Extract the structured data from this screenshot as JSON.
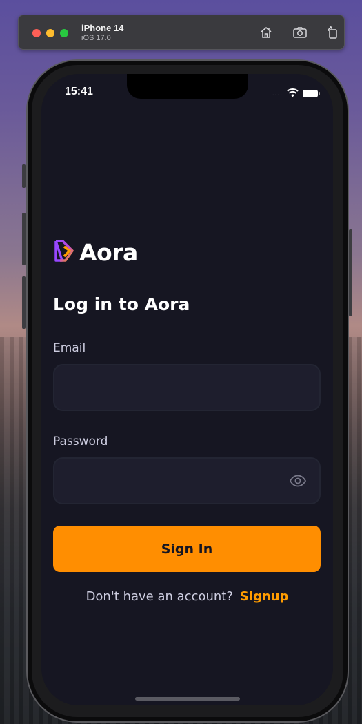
{
  "simulator": {
    "device_name": "iPhone 14",
    "os_version": "iOS 17.0",
    "icons": [
      "home-icon",
      "screenshot-icon",
      "rotate-icon"
    ]
  },
  "status_bar": {
    "time": "15:41",
    "signal": "....",
    "icons": [
      "wifi-icon",
      "battery-icon"
    ]
  },
  "app": {
    "logo_text": "Aora",
    "heading": "Log in to Aora",
    "email": {
      "label": "Email",
      "value": "",
      "placeholder": ""
    },
    "password": {
      "label": "Password",
      "value": "",
      "placeholder": ""
    },
    "signin_label": "Sign In",
    "footer": {
      "prompt": "Don't have an account?",
      "link": "Signup"
    }
  },
  "colors": {
    "screen_bg": "#161622",
    "field_bg": "#1e1e2d",
    "accent": "#ff8e01",
    "link": "#ff9c01",
    "muted_text": "#cdcde0"
  }
}
